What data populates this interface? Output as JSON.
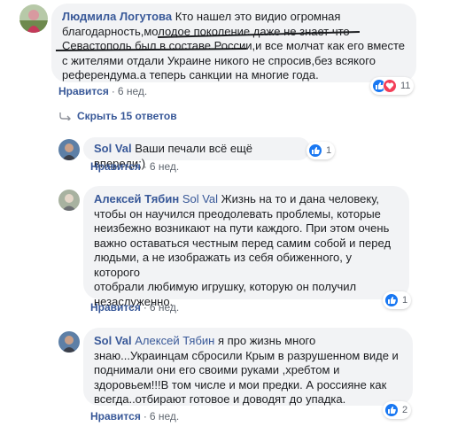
{
  "comments": [
    {
      "author": "Людмила Логутова",
      "lines": [
        "Кто нашел это видио огромная",
        "благодарность,молодое поколение даже не знает что",
        "Севастополь был в составе России,и все молчат как его вместе",
        "с жителями отдали Украине никого не спросив,без всякого",
        "референдума.а теперь санкции на многие года."
      ],
      "like_label": "Нравится",
      "time": "6 нед.",
      "reaction_count": "11"
    },
    {
      "author": "Sol Val",
      "text": "Ваши печали всё ещё впереди;)",
      "like_label": "Нравится",
      "time": "6 нед.",
      "reaction_count": "1"
    },
    {
      "author": "Алексей Тябин",
      "mention": "Sol Val",
      "lines_first": "Жизнь на то и дана человеку,",
      "lines": [
        "чтобы он научился преодолевать проблемы, которые",
        "неизбежно возникают на пути каждого. При этом очень",
        "важно оставаться честным перед самим собой и перед",
        "людьми, а не изображать из себя обиженного, у которого",
        "отобрали любимую игрушку, которую он получил",
        "незаслуженно."
      ],
      "like_label": "Нравится",
      "time": "6 нед.",
      "reaction_count": "1"
    },
    {
      "author": "Sol Val",
      "mention": "Алексей Тябин",
      "lines_first": "я про жизнь много",
      "lines": [
        "знаю...Украинцам сбросили Крым в разрушенном виде и",
        "поднимали они его своими руками ,хребтом и",
        "здоровьем!!!В том числе и мои предки. А россияне как",
        "всегда..отбирают готовое и доводят до упадка."
      ],
      "like_label": "Нравится",
      "time": "6 нед.",
      "reaction_count": "2"
    }
  ],
  "hide_replies_label": "Скрыть 15 ответов",
  "separator": "·",
  "colors": {
    "link": "#385898",
    "bubble": "#f2f3f5",
    "like": "#1877f2",
    "love": "#f33e58"
  }
}
